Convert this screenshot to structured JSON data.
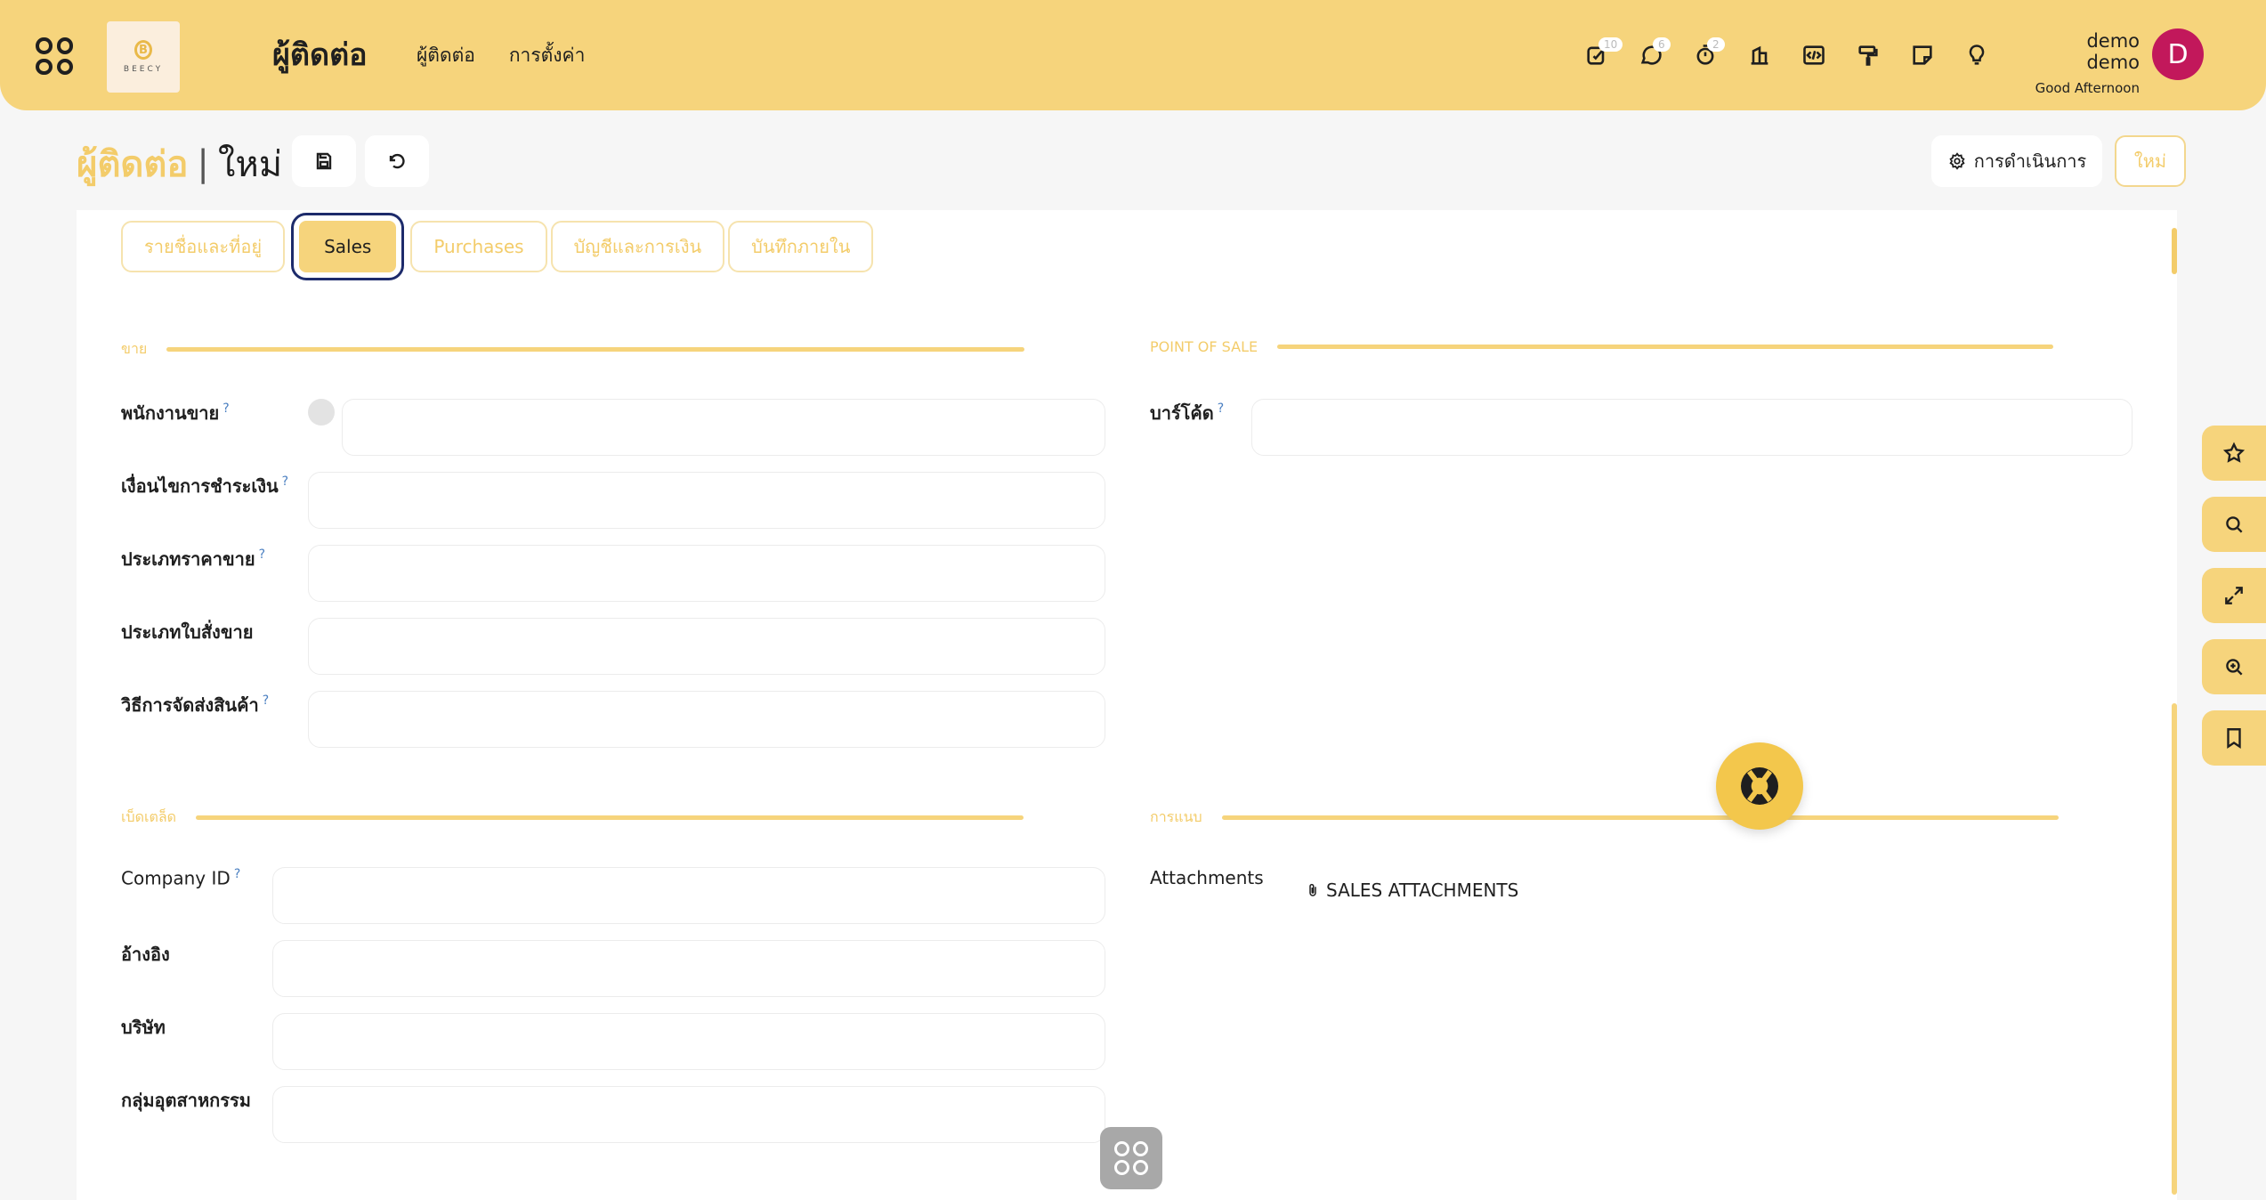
{
  "header": {
    "logo_text": "BEECY",
    "logo_mark": "B",
    "module_title": "ผู้ติดต่อ",
    "menu": [
      "ผู้ติดต่อ",
      "การตั้งค่า"
    ],
    "badges": {
      "activity": "10",
      "messages": "6",
      "timer": "2"
    },
    "user_name": "demo demo",
    "user_greeting": "Good Afternoon",
    "avatar_letter": "D"
  },
  "breadcrumb": {
    "parent": "ผู้ติดต่อ",
    "separator": "|",
    "current": "ใหม่"
  },
  "controls": {
    "action_label": "การดำเนินการ",
    "new_label": "ใหม่"
  },
  "tabs": [
    "รายชื่อและที่อยู่",
    "Sales",
    "Purchases",
    "บัญชีและการเงิน",
    "บันทึกภายใน"
  ],
  "sections": {
    "sales": "ขาย",
    "pos": "POINT OF SALE",
    "misc": "เบ็ดเตล็ด",
    "attachments": "การแนบ"
  },
  "fields": {
    "salesperson": {
      "label": "พนักงานขาย",
      "value": ""
    },
    "payment_terms": {
      "label": "เงื่อนไขการชำระเงิน",
      "value": ""
    },
    "pricelist": {
      "label": "ประเภทราคาขาย",
      "value": ""
    },
    "sale_order_type": {
      "label": "ประเภทใบสั่งขาย",
      "value": ""
    },
    "delivery_method": {
      "label": "วิธีการจัดส่งสินค้า",
      "value": ""
    },
    "barcode": {
      "label": "บาร์โค้ด",
      "value": ""
    },
    "company_id": {
      "label": "Company ID",
      "value": ""
    },
    "reference": {
      "label": "อ้างอิง",
      "value": ""
    },
    "company": {
      "label": "บริษัท",
      "value": ""
    },
    "industry": {
      "label": "กลุ่มอุตสาหกรรม",
      "value": ""
    },
    "attachments": {
      "label": "Attachments"
    }
  },
  "help_mark": "?",
  "attachment_button": "SALES ATTACHMENTS",
  "colors": {
    "primary": "#f6d47c",
    "accent": "#f3cc6a",
    "avatar": "#c2185b",
    "tab_focus": "#1d2b6b"
  }
}
